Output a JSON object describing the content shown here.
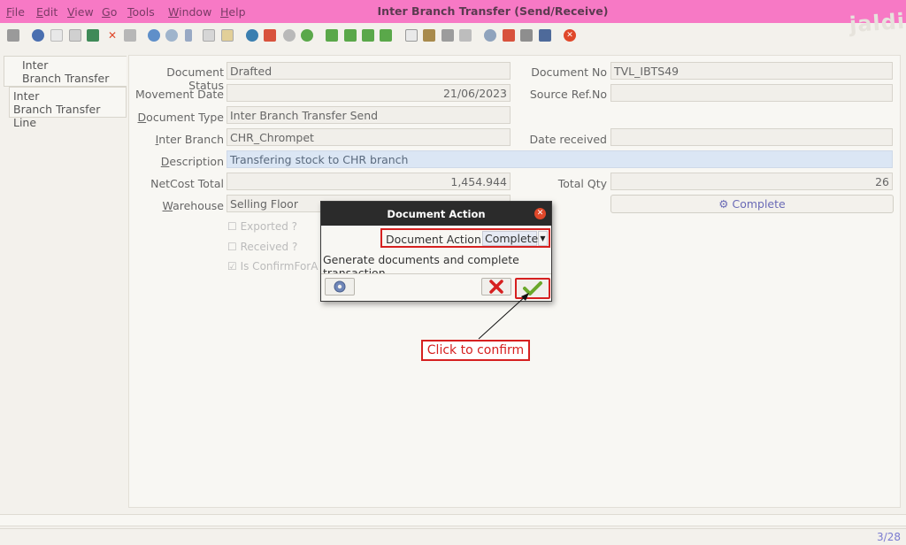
{
  "window": {
    "title": "Inter Branch Transfer (Send/Receive)",
    "menu": [
      {
        "label": "File"
      },
      {
        "label": "Edit"
      },
      {
        "label": "View"
      },
      {
        "label": "Go"
      },
      {
        "label": "Tools"
      },
      {
        "label": "Window"
      },
      {
        "label": "Help"
      }
    ],
    "logo_text": "jaldi"
  },
  "tabs": [
    {
      "line1": "Inter",
      "line2": "Branch Transfer"
    },
    {
      "line1": "Inter",
      "line2": "Branch Transfer Line"
    }
  ],
  "form": {
    "document_status": {
      "label": "Document Status",
      "value": "Drafted"
    },
    "document_no": {
      "label": "Document No",
      "value": "TVL_IBTS49"
    },
    "movement_date": {
      "label": "Movement Date",
      "value": "21/06/2023"
    },
    "source_ref_no": {
      "label": "Source Ref.No",
      "value": ""
    },
    "document_type": {
      "label": "Document Type",
      "value": "Inter Branch Transfer Send"
    },
    "inter_branch": {
      "label": "Inter Branch",
      "value": "CHR_Chrompet"
    },
    "date_received": {
      "label": "Date received",
      "value": ""
    },
    "description": {
      "label": "Description",
      "value": "Transfering stock to CHR branch"
    },
    "netcost_total": {
      "label": "NetCost Total",
      "value": "1,454.944"
    },
    "total_qty": {
      "label": "Total Qty",
      "value": "26"
    },
    "warehouse": {
      "label": "Warehouse",
      "value": "Selling Floor"
    },
    "exported": {
      "label": "Exported ?"
    },
    "received": {
      "label": "Received ?"
    },
    "is_confirm": {
      "label": "Is ConfirmForA"
    },
    "complete_button": "Complete"
  },
  "dialog": {
    "title": "Document Action",
    "field_label": "Document Action",
    "selected": "Complete",
    "description": "Generate documents and complete transaction"
  },
  "annotation": "Click to confirm",
  "status": {
    "record_count": "3/28"
  },
  "colors": {
    "titlebar": "#f779c5",
    "highlight": "#d62020",
    "dialog_header": "#2b2b2b"
  }
}
